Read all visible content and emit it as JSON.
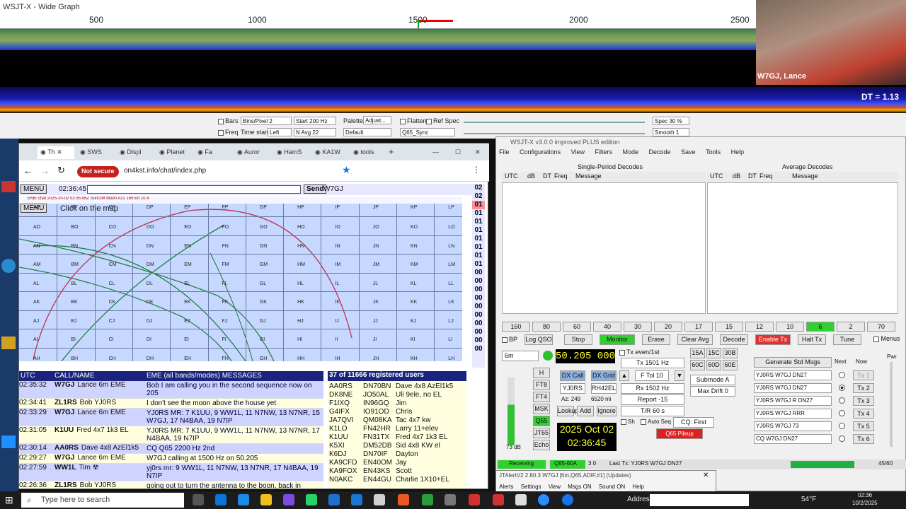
{
  "wide_graph": {
    "title": "WSJT-X - Wide Graph",
    "ticks": [
      "500",
      "1000",
      "1500",
      "2000",
      "2500"
    ],
    "dt_label": "DT =  1.13",
    "controls": {
      "bars": "Bars",
      "freq": "Freq",
      "bins_label": "Bins/Pixel 2",
      "start_label": "Start 200 Hz",
      "timestamp": "Time stamp",
      "timestamp_val": "Left",
      "navg": "N Avg 22",
      "palette": "Palette",
      "adjust": "Adjust...",
      "palette_val": "Default",
      "flatten": "Flatten",
      "refspec": "Ref Spec",
      "sync": "Q65_Sync",
      "spec": "Spec 30 %",
      "smooth": "Smooth 1"
    }
  },
  "webcam": {
    "label": "W7GJ, Lance"
  },
  "browser": {
    "tabs": [
      "Th",
      "SWS",
      "Displ",
      "Planet",
      "Fa",
      "Auror",
      "HamS",
      "KA1W",
      "tools"
    ],
    "not_secure": "Not secure",
    "url": "on4kst.info/chat/index.php",
    "chat": {
      "menu_label": "MENU",
      "time": "02:36:45",
      "send": "Send",
      "user": "W7GJ",
      "map_hint": "Click on the map",
      "map_caption": "EME chat 2025-10-02 02:35:06Z  Sun/2M  Moon Az1 169 Elt 10.4",
      "times_col": [
        "02",
        "02",
        "01",
        "01",
        "01",
        "01",
        "01",
        "01",
        "01",
        "01",
        "00",
        "00",
        "00",
        "00",
        "00",
        "00",
        "00",
        "00",
        "00",
        "00"
      ]
    },
    "grid_cols": [
      "AP",
      "BP",
      "CP",
      "DP",
      "EP",
      "FP",
      "GP",
      "HP",
      "IP",
      "JP",
      "KP",
      "LP"
    ],
    "grid_rows": [
      [
        "AO",
        "BO",
        "CO",
        "DO",
        "EO",
        "FO",
        "GO",
        "HO",
        "IO",
        "JO",
        "KO",
        "LO"
      ],
      [
        "AN",
        "BN",
        "CN",
        "DN",
        "EN",
        "FN",
        "GN",
        "HN",
        "IN",
        "JN",
        "KN",
        "LN"
      ],
      [
        "AM",
        "BM",
        "CM",
        "DM",
        "EM",
        "FM",
        "GM",
        "HM",
        "IM",
        "JM",
        "KM",
        "LM"
      ],
      [
        "AL",
        "BL",
        "CL",
        "DL",
        "EL",
        "FL",
        "GL",
        "HL",
        "IL",
        "JL",
        "KL",
        "LL"
      ],
      [
        "AK",
        "BK",
        "CK",
        "DK",
        "EK",
        "FK",
        "GK",
        "HK",
        "IK",
        "JK",
        "KK",
        "LK"
      ],
      [
        "AJ",
        "BJ",
        "CJ",
        "DJ",
        "EJ",
        "FJ",
        "GJ",
        "HJ",
        "IJ",
        "JJ",
        "KJ",
        "LJ"
      ],
      [
        "AI",
        "BI",
        "CI",
        "DI",
        "EI",
        "FI",
        "GI",
        "HI",
        "II",
        "JI",
        "KI",
        "LI"
      ],
      [
        "AH",
        "BH",
        "CH",
        "DH",
        "EH",
        "FH",
        "GH",
        "HH",
        "IH",
        "JH",
        "KH",
        "LH"
      ]
    ],
    "messages": {
      "headers": {
        "utc": "UTC",
        "call": "CALL/NAME",
        "msg": "EME (all bands/modes) MESSAGES"
      },
      "rows": [
        {
          "t": "02:35:32",
          "call": "W7GJ",
          "name": "Lance 6m EME",
          "msg": "Bob I am calling you in the second sequence now on 205",
          "hl": true
        },
        {
          "t": "02:34:41",
          "call": "ZL1RS",
          "name": "Bob YJ0RS",
          "msg": "I don't see the moon above the house yet",
          "hl": false
        },
        {
          "t": "02:33:29",
          "call": "W7GJ",
          "name": "Lance 6m EME",
          "msg": "YJ0RS MR: 7 K1UU, 9 WW1L, 11 N7NW, 13 N7NR, 15 W7GJ, 17 N4BAA, 19 N7IP",
          "hl": true
        },
        {
          "t": "02:31:05",
          "call": "K1UU",
          "name": "Fred 4x7 1k3 EL",
          "msg": "YJ0RS MR: 7 K1UU, 9 WW1L, 11 N7NW, 13 N7NR, 17 N4BAA, 19 N7IP",
          "hl": false
        },
        {
          "t": "02:30:14",
          "call": "AA0RS",
          "name": "Dave 4x8 AzEl1k5",
          "msg": "CQ Q65 2200 Hz 2nd",
          "hl": true
        },
        {
          "t": "02:29:27",
          "call": "W7GJ",
          "name": "Lance 6m EME",
          "msg": "W7GJ calling at 1500 Hz on 50.205",
          "hl": false
        },
        {
          "t": "02:27:59",
          "call": "WW1L",
          "name": "Tim ☢",
          "msg": "yj0rs mr: 9 WW1L, 11 N7NW, 13 N7NR, 17 N4BAA, 19 N7IP",
          "hl": true
        },
        {
          "t": "02:26:36",
          "call": "ZL1RS",
          "name": "Bob YJ0RS",
          "msg": "going out to turn the antenna to the boon, back in",
          "hl": false
        }
      ]
    },
    "users": {
      "header": "37 of 11666 registered users",
      "rows": [
        {
          "call": "AA0RS",
          "loc": "DN70BN",
          "name": "Dave 4x8 AzEl1k5"
        },
        {
          "call": "DK8NE",
          "loc": "JO50AL",
          "name": "Uli 9ele, no EL"
        },
        {
          "call": "F1IXQ",
          "loc": "IN96GQ",
          "name": "Jim"
        },
        {
          "call": "G4IFX",
          "loc": "IO91OD",
          "name": "Chris"
        },
        {
          "call": "JA7QVI",
          "loc": "QM08KA",
          "name": "Tac 4x7 kw"
        },
        {
          "call": "K1LO",
          "loc": "FN42HR",
          "name": "Larry 11+elev"
        },
        {
          "call": "K1UU",
          "loc": "FN31TX",
          "name": "Fred 4x7 1k3 EL"
        },
        {
          "call": "K5XI",
          "loc": "DM52DB",
          "name": "Sid 4x8 KW el"
        },
        {
          "call": "K6DJ",
          "loc": "DN70IF",
          "name": "Dayton"
        },
        {
          "call": "KA9CFD",
          "loc": "EN40OM",
          "name": "Jay"
        },
        {
          "call": "KA9FOX",
          "loc": "EN43KS",
          "name": "Scott"
        },
        {
          "call": "N0AKC",
          "loc": "EN44GU",
          "name": "Charlie 1X10+EL"
        }
      ]
    }
  },
  "wsjtx": {
    "title": "WSJT-X  v3.0.0  improved PLUS edition",
    "menu": [
      "File",
      "Configurations",
      "View",
      "Filters",
      "Mode",
      "Decode",
      "Save",
      "Tools",
      "Help"
    ],
    "single_title": "Single-Period Decodes",
    "avg_title": "Average Decodes",
    "cols": [
      "UTC",
      "dB",
      "DT",
      "Freq",
      "Message"
    ],
    "bands": [
      "160",
      "80",
      "60",
      "40",
      "30",
      "20",
      "17",
      "15",
      "12",
      "10",
      "6",
      "2",
      "70"
    ],
    "buttons": {
      "bp": "BP",
      "logqso": "Log QSO",
      "stop": "Stop",
      "monitor": "Monitor",
      "erase": "Erase",
      "clear_avg": "Clear Avg",
      "decode": "Decode",
      "enable_tx": "Enable Tx",
      "halt_tx": "Halt Tx",
      "tune": "Tune",
      "menus": "Menus"
    },
    "band_select": "6m",
    "freq": "50.205 000",
    "tx_even": "Tx even/1st",
    "modes": [
      "H",
      "FT8",
      "FT4",
      "MSK",
      "Q65",
      "JT65",
      "Echo"
    ],
    "level": "73 dB",
    "dx_call_btn": "DX Call",
    "dx_grid_btn": "DX Grid",
    "dx_call": "YJ0RS",
    "dx_grid": "RH42EL",
    "az": "Az: 249",
    "dist": "6520 mi",
    "lookup": "Lookup",
    "add": "Add",
    "ignore": "Ignore",
    "date": "2025 Oct 02",
    "clock": "02:36:45",
    "tx_hz": "Tx  1501 Hz",
    "ftol": "F Tol  10",
    "rx_hz": "Rx  1502 Hz",
    "report": "Report -15",
    "tr": "T/R  60 s",
    "sh": "Sh",
    "auto_seq": "Auto Seq",
    "cq_first": "CQ: First",
    "pileup": "Q65 Pileup",
    "tr_btns": [
      "15A",
      "15C",
      "30B",
      "60C",
      "60D",
      "60E"
    ],
    "submode": "Submode A",
    "maxdrift": "Max Drift  0",
    "gen_std": "Generate Std Msgs",
    "next": "Next",
    "now": "Now",
    "pwr": "Pwr",
    "tx_msgs": [
      "YJ0RS W7GJ DN27",
      "YJ0RS W7GJ DN27",
      "YJ0RS W7GJ R DN27",
      "YJ0RS W7GJ RRR",
      "YJ0RS W7GJ 73",
      "CQ W7GJ DN27"
    ],
    "tx_btns": [
      "Tx 1",
      "Tx 2",
      "Tx 3",
      "Tx 4",
      "Tx 5",
      "Tx 6"
    ],
    "status": {
      "receiving": "Receiving",
      "mode": "Q65-60A",
      "seq": "3  0",
      "last_tx": "Last Tx: YJ0RS W7GJ DN27",
      "count": "45/60"
    }
  },
  "jtalert": {
    "title": "JTAlertV2  2.80.3 W7GJ [6m,Q65,ADIF,#1] (Updates)",
    "menu": [
      "Alerts",
      "Settings",
      "View",
      "Msgs ON",
      "Sound ON",
      "Help"
    ]
  },
  "taskbar": {
    "search_placeholder": "Type here to search",
    "address_label": "Address",
    "weather": "54°F",
    "time": "02:36",
    "date": "10/2/2025"
  }
}
